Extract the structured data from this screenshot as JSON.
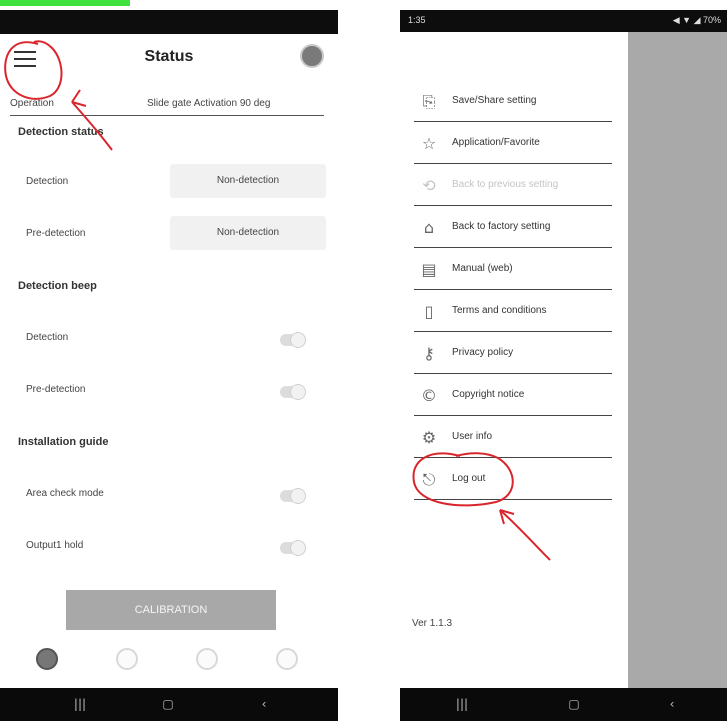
{
  "left": {
    "header": {
      "title": "Status"
    },
    "subheader": {
      "left": "Operation",
      "right": "Slide gate Activation 90 deg"
    },
    "sections": [
      {
        "title": "Detection status",
        "rows": [
          {
            "label": "Detection",
            "value": "Non-detection"
          },
          {
            "label": "Pre-detection",
            "value": "Non-detection"
          }
        ]
      },
      {
        "title": "Detection beep",
        "rows": [
          {
            "label": "Detection",
            "on": false
          },
          {
            "label": "Pre-detection",
            "on": false
          }
        ]
      },
      {
        "title": "Installation guide",
        "rows": [
          {
            "label": "Area check mode",
            "on": false
          },
          {
            "label": "Output1 hold",
            "on": false
          }
        ]
      }
    ],
    "calibration_label": "CALIBRATION",
    "nav_icons": [
      "status-icon",
      "settings-icon",
      "history-icon",
      "account-icon"
    ],
    "system_nav": [
      "|||",
      "▢",
      "‹"
    ]
  },
  "right": {
    "status_bar": {
      "time": "1:35",
      "right": "◀ ▼ ◢ 70%"
    },
    "menu": [
      {
        "label": "Save/Share setting",
        "icon": "save-share-icon",
        "glyph": "⎘",
        "enabled": true
      },
      {
        "label": "Application/Favorite",
        "icon": "star-icon",
        "glyph": "☆",
        "enabled": true
      },
      {
        "label": "Back to previous setting",
        "icon": "undo-icon",
        "glyph": "⟲",
        "enabled": false
      },
      {
        "label": "Back to factory setting",
        "icon": "factory-icon",
        "glyph": "⌂",
        "enabled": true
      },
      {
        "label": "Manual (web)",
        "icon": "manual-icon",
        "glyph": "▤",
        "enabled": true
      },
      {
        "label": "Terms and conditions",
        "icon": "terms-icon",
        "glyph": "▯",
        "enabled": true
      },
      {
        "label": "Privacy policy",
        "icon": "key-icon",
        "glyph": "⚷",
        "enabled": true
      },
      {
        "label": "Copyright notice",
        "icon": "copyright-icon",
        "glyph": "©",
        "enabled": true
      },
      {
        "label": "User info",
        "icon": "gear-icon",
        "glyph": "⚙",
        "enabled": true
      },
      {
        "label": "Log out",
        "icon": "logout-icon",
        "glyph": "⎋",
        "enabled": true
      }
    ],
    "version": "Ver 1.1.3",
    "system_nav": [
      "|||",
      "▢",
      "‹"
    ]
  },
  "colors": {
    "accent_green": "#3ee13e",
    "annotation_red": "#d9262c"
  }
}
